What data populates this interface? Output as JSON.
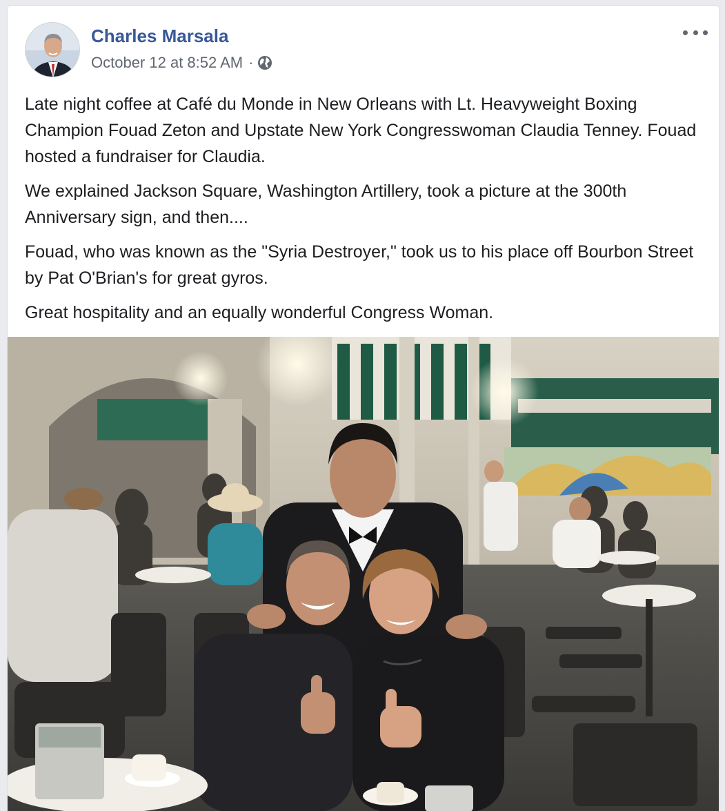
{
  "post": {
    "author": "Charles Marsala",
    "timestamp": "October 12 at 8:52 AM",
    "separator": "·",
    "privacy_icon": "globe-icon",
    "more_icon": "more-options-icon",
    "paragraphs": [
      "Late night coffee at Café du Monde in New Orleans with Lt. Heavyweight Boxing Champion Fouad Zeton and Upstate New York Congresswoman Claudia Tenney. Fouad hosted a fundraiser for Claudia.",
      "We explained Jackson Square, Washington Artillery, took a picture at the 300th Anniversary sign, and then....",
      "Fouad, who was known as the \"Syria Destroyer,\" took us to his place off Bourbon Street by Pat O'Brian's for great gyros.",
      "Great hospitality and an equally wonderful Congress Woman."
    ]
  },
  "colors": {
    "author_link": "#385898",
    "meta_text": "#616770",
    "body_text": "#1c1e21",
    "page_bg": "#e9ebee",
    "awning_green": "#1f5a45"
  }
}
